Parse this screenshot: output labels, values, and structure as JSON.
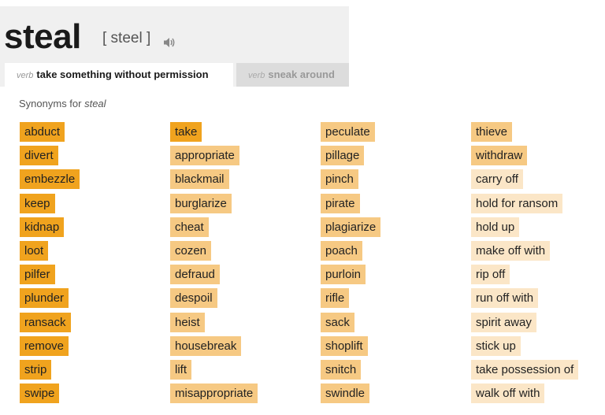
{
  "entry": {
    "word": "steal",
    "pronunciation": "[ steel ]",
    "icon": "speaker-icon"
  },
  "tabs": [
    {
      "pos": "verb",
      "definition": "take something without permission"
    },
    {
      "pos": "verb",
      "definition": "sneak around"
    }
  ],
  "synonyms_label": {
    "prefix": "Synonyms for ",
    "word": "steal"
  },
  "colors": {
    "relevance_high": "#f0a31e",
    "relevance_medium": "#f6c983",
    "relevance_low": "#fbe6c7"
  },
  "columns": [
    [
      {
        "text": "abduct",
        "relevance": 3
      },
      {
        "text": "divert",
        "relevance": 3
      },
      {
        "text": "embezzle",
        "relevance": 3
      },
      {
        "text": "keep",
        "relevance": 3
      },
      {
        "text": "kidnap",
        "relevance": 3
      },
      {
        "text": "loot",
        "relevance": 3
      },
      {
        "text": "pilfer",
        "relevance": 3
      },
      {
        "text": "plunder",
        "relevance": 3
      },
      {
        "text": "ransack",
        "relevance": 3
      },
      {
        "text": "remove",
        "relevance": 3
      },
      {
        "text": "strip",
        "relevance": 3
      },
      {
        "text": "swipe",
        "relevance": 3
      }
    ],
    [
      {
        "text": "take",
        "relevance": 3
      },
      {
        "text": "appropriate",
        "relevance": 2
      },
      {
        "text": "blackmail",
        "relevance": 2
      },
      {
        "text": "burglarize",
        "relevance": 2
      },
      {
        "text": "cheat",
        "relevance": 2
      },
      {
        "text": "cozen",
        "relevance": 2
      },
      {
        "text": "defraud",
        "relevance": 2
      },
      {
        "text": "despoil",
        "relevance": 2
      },
      {
        "text": "heist",
        "relevance": 2
      },
      {
        "text": "housebreak",
        "relevance": 2
      },
      {
        "text": "lift",
        "relevance": 2
      },
      {
        "text": "misappropriate",
        "relevance": 2
      }
    ],
    [
      {
        "text": "peculate",
        "relevance": 2
      },
      {
        "text": "pillage",
        "relevance": 2
      },
      {
        "text": "pinch",
        "relevance": 2
      },
      {
        "text": "pirate",
        "relevance": 2
      },
      {
        "text": "plagiarize",
        "relevance": 2
      },
      {
        "text": "poach",
        "relevance": 2
      },
      {
        "text": "purloin",
        "relevance": 2
      },
      {
        "text": "rifle",
        "relevance": 2
      },
      {
        "text": "sack",
        "relevance": 2
      },
      {
        "text": "shoplift",
        "relevance": 2
      },
      {
        "text": "snitch",
        "relevance": 2
      },
      {
        "text": "swindle",
        "relevance": 2
      }
    ],
    [
      {
        "text": "thieve",
        "relevance": 2
      },
      {
        "text": "withdraw",
        "relevance": 2
      },
      {
        "text": "carry off",
        "relevance": 1
      },
      {
        "text": "hold for ransom",
        "relevance": 1
      },
      {
        "text": "hold up",
        "relevance": 1
      },
      {
        "text": "make off with",
        "relevance": 1
      },
      {
        "text": "rip off",
        "relevance": 1
      },
      {
        "text": "run off with",
        "relevance": 1
      },
      {
        "text": "spirit away",
        "relevance": 1
      },
      {
        "text": "stick up",
        "relevance": 1
      },
      {
        "text": "take possession of",
        "relevance": 1
      },
      {
        "text": "walk off with",
        "relevance": 1
      }
    ]
  ]
}
